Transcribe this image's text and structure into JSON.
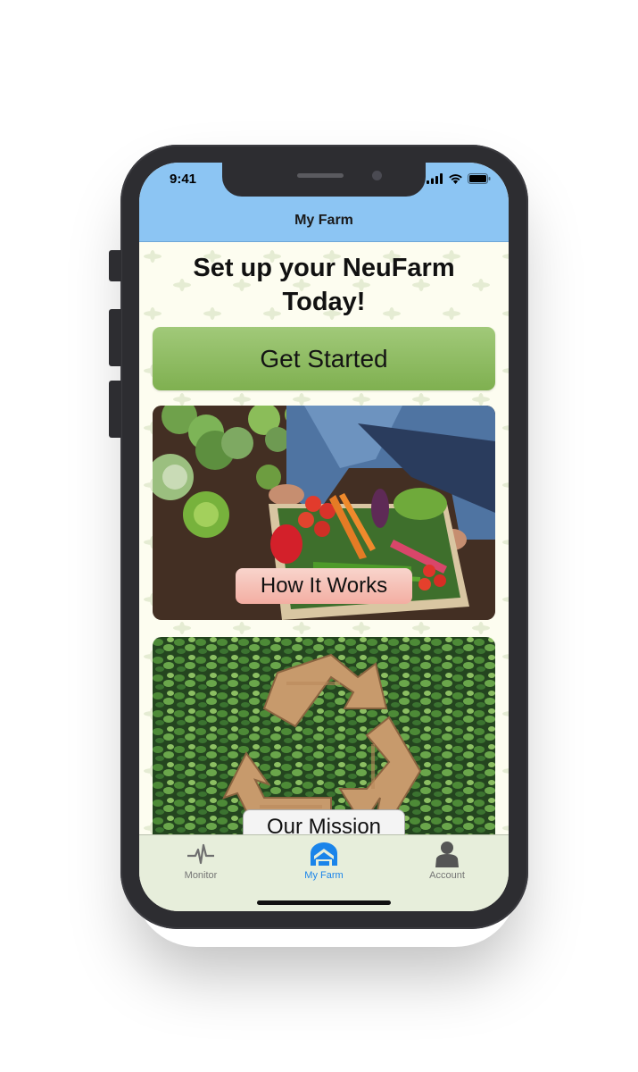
{
  "status": {
    "time": "9:41"
  },
  "nav": {
    "title": "My Farm"
  },
  "hero": {
    "headline_line1": "Set up your NeuFarm",
    "headline_line2": "Today!"
  },
  "actions": {
    "get_started": "Get Started"
  },
  "cards": [
    {
      "button_label": "How It Works",
      "image": "farmer-vegetable-crate-photo"
    },
    {
      "button_label": "Our Mission",
      "image": "recycle-symbol-ivy-photo"
    }
  ],
  "tabs": [
    {
      "label": "Monitor",
      "icon": "heartbeat-icon",
      "active": false
    },
    {
      "label": "My Farm",
      "icon": "greenhouse-icon",
      "active": true
    },
    {
      "label": "Account",
      "icon": "person-icon",
      "active": false
    }
  ],
  "colors": {
    "header": "#8cc5f3",
    "content_background": "#fdfdf0",
    "get_started": "#8fbd62",
    "how_it_works_button": "#f5bfb5",
    "tab_active": "#1a84ea",
    "tab_inactive": "#757575",
    "tabbar": "#e7eedb"
  }
}
